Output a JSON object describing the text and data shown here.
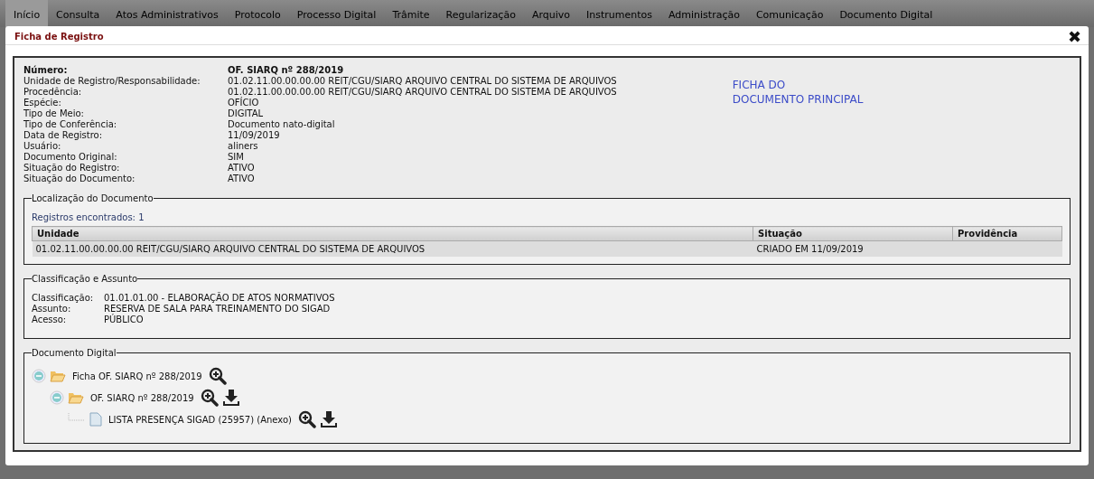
{
  "menu": [
    {
      "label": "Início",
      "selected": true
    },
    {
      "label": "Consulta",
      "selected": false
    },
    {
      "label": "Atos Administrativos",
      "selected": false
    },
    {
      "label": "Protocolo",
      "selected": false
    },
    {
      "label": "Processo Digital",
      "selected": false
    },
    {
      "label": "Trâmite",
      "selected": false
    },
    {
      "label": "Regularização",
      "selected": false
    },
    {
      "label": "Arquivo",
      "selected": false
    },
    {
      "label": "Instrumentos",
      "selected": false
    },
    {
      "label": "Administração",
      "selected": false
    },
    {
      "label": "Comunicação",
      "selected": false
    },
    {
      "label": "Documento Digital",
      "selected": false
    }
  ],
  "dialog": {
    "title": "Ficha de Registro",
    "close": "✖"
  },
  "number": {
    "label": "Número:",
    "value": "OF. SIARQ nº 288/2019"
  },
  "fields": [
    {
      "label": "Unidade de Registro/Responsabilidade:",
      "value": "01.02.11.00.00.00.00 REIT/CGU/SIARQ ARQUIVO CENTRAL DO SISTEMA DE ARQUIVOS"
    },
    {
      "label": "Procedência:",
      "value": "01.02.11.00.00.00.00 REIT/CGU/SIARQ ARQUIVO CENTRAL DO SISTEMA DE ARQUIVOS"
    },
    {
      "label": "Espécie:",
      "value": "OFÍCIO"
    },
    {
      "label": "Tipo de Meio:",
      "value": "DIGITAL"
    },
    {
      "label": "Tipo de Conferência:",
      "value": "Documento nato-digital"
    },
    {
      "label": "Data de Registro:",
      "value": "11/09/2019"
    },
    {
      "label": "Usuário:",
      "value": "aliners"
    },
    {
      "label": "Documento Original:",
      "value": "SIM"
    },
    {
      "label": "Situação do Registro:",
      "value": "ATIVO"
    },
    {
      "label": "Situação do Documento:",
      "value": "ATIVO"
    }
  ],
  "heading": [
    "FICHA DO",
    "DOCUMENTO PRINCIPAL"
  ],
  "location": {
    "legend": "Localização do Documento",
    "count": "Registros encontrados: 1",
    "columns": [
      "Unidade",
      "Situação",
      "Providência"
    ],
    "rows": [
      [
        "01.02.11.00.00.00.00 REIT/CGU/SIARQ ARQUIVO CENTRAL DO SISTEMA DE ARQUIVOS",
        "CRIADO EM  11/09/2019",
        ""
      ]
    ]
  },
  "classification": {
    "legend": "Classificação e Assunto",
    "fields": [
      {
        "label": "Classificação:",
        "value": "01.01.01.00 - ELABORAÇÃO DE ATOS NORMATIVOS"
      },
      {
        "label": "Assunto:",
        "value": "RESERVA DE SALA PARA TREINAMENTO DO SIGAD"
      },
      {
        "label": "Acesso:",
        "value": "PÚBLICO"
      }
    ]
  },
  "digital": {
    "legend": "Documento Digital",
    "tree": [
      {
        "kind": "folder",
        "label": "Ficha OF. SIARQ nº 288/2019",
        "expanded": true,
        "downloadable": false,
        "children": [
          {
            "kind": "folder",
            "label": "OF. SIARQ nº 288/2019",
            "expanded": true,
            "downloadable": true,
            "children": [
              {
                "kind": "file",
                "label": "LISTA PRESENÇA SIGAD (25957) (Anexo)",
                "downloadable": true
              }
            ]
          }
        ]
      }
    ]
  }
}
